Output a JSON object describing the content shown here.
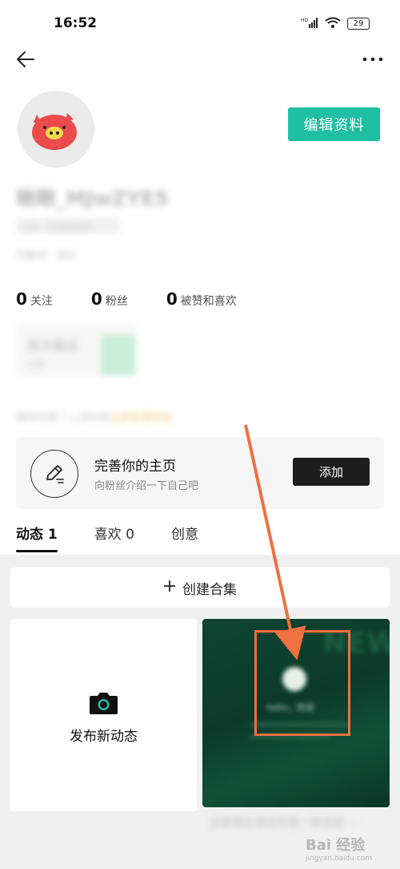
{
  "status_bar": {
    "time": "16:52",
    "network": "HD",
    "battery": "29"
  },
  "header": {
    "back_icon": "back-arrow-icon",
    "more_icon": "more-dots-icon"
  },
  "profile": {
    "nickname": "瞅瞅_MJwZYE5",
    "badge_text": "认证 · 无特别说明",
    "sub_text": "IP属地：湖北",
    "edit_button": "编辑资料"
  },
  "stats": [
    {
      "count": "0",
      "label": "关注"
    },
    {
      "count": "0",
      "label": "粉丝"
    },
    {
      "count": "0",
      "label": "被赞和喜欢"
    }
  ],
  "digital_card": {
    "title": "数字藏品",
    "sub": "去看"
  },
  "tip": {
    "text": "确保完善个人资料即",
    "highlight": "立即获得奖励"
  },
  "complete_card": {
    "title": "完善你的主页",
    "subtitle": "向粉丝介绍一下自己吧",
    "add_button": "添加"
  },
  "tabs": [
    {
      "label": "动态 1",
      "active": true
    },
    {
      "label": "喜欢 0",
      "active": false
    },
    {
      "label": "创意",
      "active": false
    }
  ],
  "create_collection": {
    "icon": "plus-icon",
    "label": "创建合集"
  },
  "publish_tile": {
    "icon": "camera-icon",
    "label": "发布新动态"
  },
  "post_tile": {
    "overlay_text": "hello，欢迎",
    "caption": "这是我在滚动页面一条动态 —"
  },
  "watermark": {
    "brand": "Bai 经验",
    "url": "jingyan.baidu.com"
  },
  "colors": {
    "accent": "#1fbfa3",
    "annotation": "#ef7040",
    "dark_button": "#1d1d1d"
  }
}
